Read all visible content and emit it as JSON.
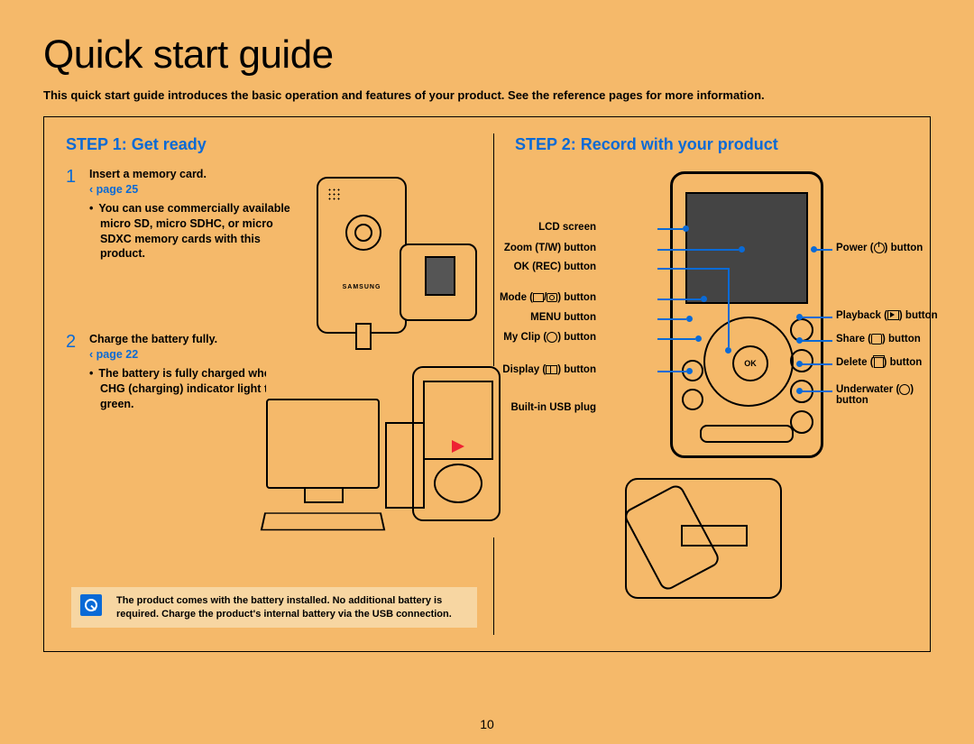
{
  "title": "Quick start guide",
  "intro": "This quick start guide introduces the basic operation and features of your product. See the reference pages for more information.",
  "page_number": "10",
  "step1": {
    "heading": "STEP 1: Get ready",
    "device_brand": "SAMSUNG",
    "items": [
      {
        "n": "1",
        "text": "Insert a memory card.",
        "page_ref": "‹ page 25",
        "bullet": "You can use commercially available micro SD, micro SDHC, or micro SDXC memory cards with this product."
      },
      {
        "n": "2",
        "text": "Charge the battery fully.",
        "page_ref": "‹ page 22",
        "bullet": "The battery is fully charged when the CHG (charging) indicator light turns green."
      }
    ],
    "note": "The product comes with the battery installed. No additional battery is required. Charge the product's internal battery via the USB connection."
  },
  "step2": {
    "heading": "STEP 2: Record with your product",
    "ok_label": "OK",
    "labels_left": {
      "lcd": "LCD screen",
      "zoom": "Zoom (T/W) button",
      "okrec": "OK (REC) button",
      "mode_pre": "Mode (",
      "mode_post": ") button",
      "menu": "MENU button",
      "myclip_pre": "My Clip (",
      "myclip_post": ") button",
      "display_pre": "Display (",
      "display_post": ") button",
      "usb": "Built-in USB plug"
    },
    "labels_right": {
      "power_pre": "Power (",
      "power_post": ") button",
      "playback_pre": "Playback (",
      "playback_post": ") button",
      "share_pre": "Share (",
      "share_post": ") button",
      "delete_pre": "Delete (",
      "delete_post": ") button",
      "underwater_pre": "Underwater (",
      "underwater_post": ") button"
    }
  }
}
